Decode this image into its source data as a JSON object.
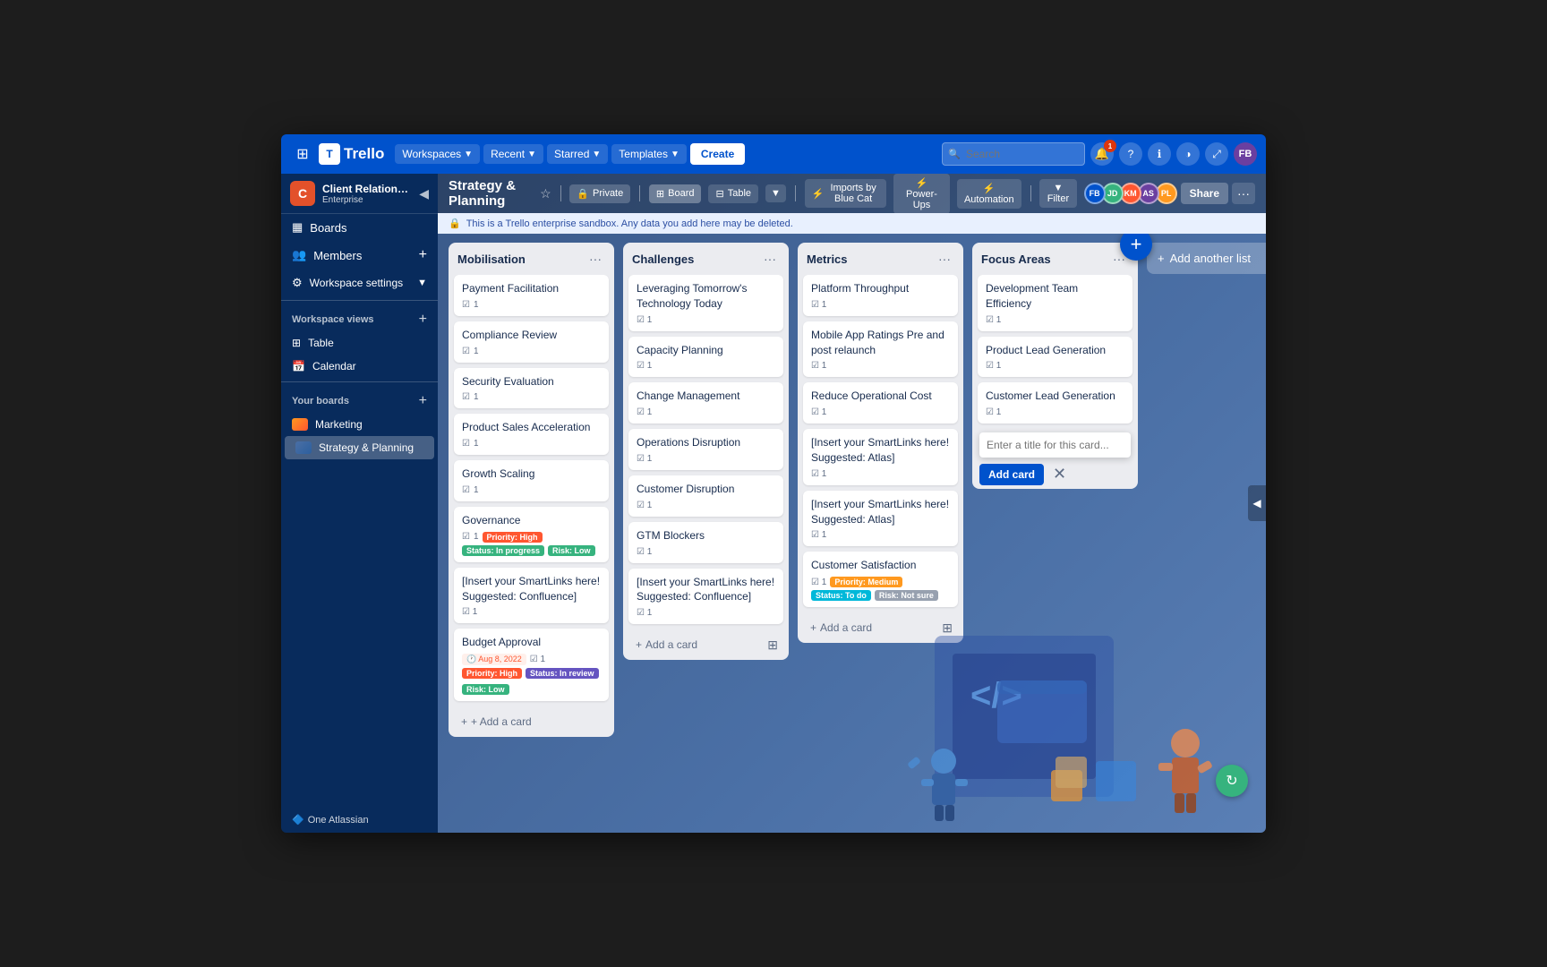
{
  "app": {
    "title": "Trello",
    "logo": "C"
  },
  "header": {
    "workspaces": "Workspaces",
    "recent": "Recent",
    "starred": "Starred",
    "templates": "Templates",
    "create": "Create",
    "search_placeholder": "Search",
    "notification_count": "1"
  },
  "sidebar": {
    "workspace_name": "Client Relationships",
    "workspace_type": "Enterprise",
    "workspace_icon": "C",
    "boards_label": "Boards",
    "members_label": "Members",
    "settings_label": "Workspace settings",
    "workspace_views": "Workspace views",
    "table_label": "Table",
    "calendar_label": "Calendar",
    "your_boards": "Your boards",
    "marketing_board": "Marketing",
    "strategy_board": "Strategy & Planning",
    "bottom_label": "One Atlassian"
  },
  "board": {
    "title": "Strategy & Planning",
    "is_private": "Private",
    "view_board": "Board",
    "view_table": "Table",
    "imports": "Imports by Blue Cat",
    "power_ups": "Power-Ups",
    "automation": "Automation",
    "filter": "Filter",
    "share": "Share"
  },
  "banner": {
    "text": "This is a Trello enterprise sandbox. Any data you add here may be deleted."
  },
  "lists": [
    {
      "id": "mobilisation",
      "title": "Mobilisation",
      "cards": [
        {
          "id": "m1",
          "title": "Payment Facilitation",
          "checklist": "1"
        },
        {
          "id": "m2",
          "title": "Compliance Review",
          "checklist": "1"
        },
        {
          "id": "m3",
          "title": "Security Evaluation",
          "checklist": "1"
        },
        {
          "id": "m4",
          "title": "Product Sales Acceleration",
          "checklist": "1"
        },
        {
          "id": "m5",
          "title": "Growth Scaling",
          "checklist": "1"
        },
        {
          "id": "m6",
          "title": "Governance",
          "badges": [
            "priority_high",
            "status_inprogress",
            "risk_low"
          ],
          "checklist": "1"
        },
        {
          "id": "m7",
          "title": "[Insert your SmartLinks here! Suggested: Confluence]",
          "checklist": "1"
        },
        {
          "id": "m8",
          "title": "Budget Approval",
          "date": "Aug 8, 2022",
          "badges": [
            "priority_high",
            "status_inreview",
            "risk_low"
          ],
          "checklist": "1"
        }
      ]
    },
    {
      "id": "challenges",
      "title": "Challenges",
      "cards": [
        {
          "id": "c1",
          "title": "Leveraging Tomorrow's Technology Today",
          "checklist": "1"
        },
        {
          "id": "c2",
          "title": "Capacity Planning",
          "checklist": "1"
        },
        {
          "id": "c3",
          "title": "Change Management",
          "checklist": "1"
        },
        {
          "id": "c4",
          "title": "Operations Disruption",
          "checklist": "1"
        },
        {
          "id": "c5",
          "title": "Customer Disruption",
          "checklist": "1"
        },
        {
          "id": "c6",
          "title": "GTM Blockers",
          "checklist": "1"
        },
        {
          "id": "c7",
          "title": "[Insert your SmartLinks here! Suggested: Confluence]",
          "checklist": "1"
        }
      ]
    },
    {
      "id": "metrics",
      "title": "Metrics",
      "cards": [
        {
          "id": "me1",
          "title": "Platform Throughput",
          "checklist": "1"
        },
        {
          "id": "me2",
          "title": "Mobile App Ratings Pre and post relaunch",
          "checklist": "1"
        },
        {
          "id": "me3",
          "title": "Reduce Operational Cost",
          "checklist": "1"
        },
        {
          "id": "me4",
          "title": "[Insert your SmartLinks here! Suggested: Atlas]",
          "checklist": "1"
        },
        {
          "id": "me5",
          "title": "[Insert your SmartLinks here! Suggested: Atlas]",
          "checklist": "1"
        },
        {
          "id": "me6",
          "title": "Customer Satisfaction",
          "badges": [
            "priority_medium",
            "status_todo",
            "risk_notsure"
          ],
          "checklist": "1"
        }
      ]
    },
    {
      "id": "focus_areas",
      "title": "Focus Areas",
      "cards": [
        {
          "id": "fa1",
          "title": "Development Team Efficiency",
          "checklist": "1"
        },
        {
          "id": "fa2",
          "title": "Product Lead Generation",
          "checklist": "1"
        },
        {
          "id": "fa3",
          "title": "Customer Lead Generation",
          "checklist": "1"
        }
      ],
      "show_input": true,
      "input_placeholder": "Enter a title for this card...",
      "add_card_label": "Add card",
      "cancel_label": "✕"
    }
  ],
  "add_another_list": "Add another list",
  "add_a_card": "+ Add a card",
  "badges": {
    "priority_high": "Priority: High",
    "priority_medium": "Priority: Medium",
    "status_inprogress": "Status: In progress",
    "status_inreview": "Status: In review",
    "status_todo": "Status: To do",
    "risk_low": "Risk: Low",
    "risk_notsure": "Risk: Not sure"
  }
}
